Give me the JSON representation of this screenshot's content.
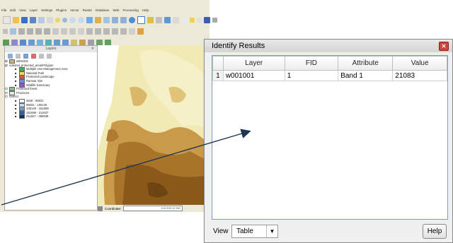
{
  "qgis": {
    "menus": [
      "File",
      "Edit",
      "View",
      "Layer",
      "Settings",
      "Plugins",
      "Vector",
      "Raster",
      "Database",
      "Web",
      "Processing",
      "Help"
    ],
    "layers_panel": {
      "title": "Layers",
      "items": [
        {
          "label": "w001001",
          "swatch": ""
        },
        {
          "label": "national_protected_areasPolygon",
          "swatch": ""
        },
        {
          "label": "Multiple Use Management Area",
          "swatch": "#4caf50"
        },
        {
          "label": "National Park",
          "swatch": "#e6e24a"
        },
        {
          "label": "Protected Landscape",
          "swatch": "#d9534f"
        },
        {
          "label": "Ramsar Site",
          "swatch": "#6a8fd6"
        },
        {
          "label": "Wildlife Sanctuary",
          "swatch": "#9c4fd0"
        },
        {
          "label": "Protected forest",
          "swatch": "#7cc27c"
        },
        {
          "label": "Provinces",
          "swatch": "#e8e8e8"
        },
        {
          "label": "District",
          "swatch": ""
        },
        {
          "label": "3848 - 96031",
          "swatch": "#ffffff"
        },
        {
          "label": "96031 - 105145",
          "swatch": "#c7d8ee"
        },
        {
          "label": "105145 - 151699",
          "swatch": "#6f9fd0"
        },
        {
          "label": "151699 - 211827",
          "swatch": "#2f5fa0"
        },
        {
          "label": "211827 - 380839",
          "swatch": "#0f2f6a"
        }
      ]
    },
    "status": {
      "coordinate_label": "Coordinate:",
      "coordinate_value": "104.535,10.962"
    }
  },
  "dialog": {
    "title": "Identify Results",
    "columns": [
      "Layer",
      "FID",
      "Attribute",
      "Value"
    ],
    "rows": [
      {
        "num": "1",
        "layer": "w001001",
        "fid": "1",
        "attribute": "Band 1",
        "value": "21083"
      }
    ],
    "view_label": "View",
    "view_value": "Table",
    "help_label": "Help"
  },
  "colors": {
    "dialog_border": "#7a9cd3",
    "close_button": "#d0433b",
    "map_light": "#f2eab4",
    "map_dark": "#8b5a1a"
  }
}
